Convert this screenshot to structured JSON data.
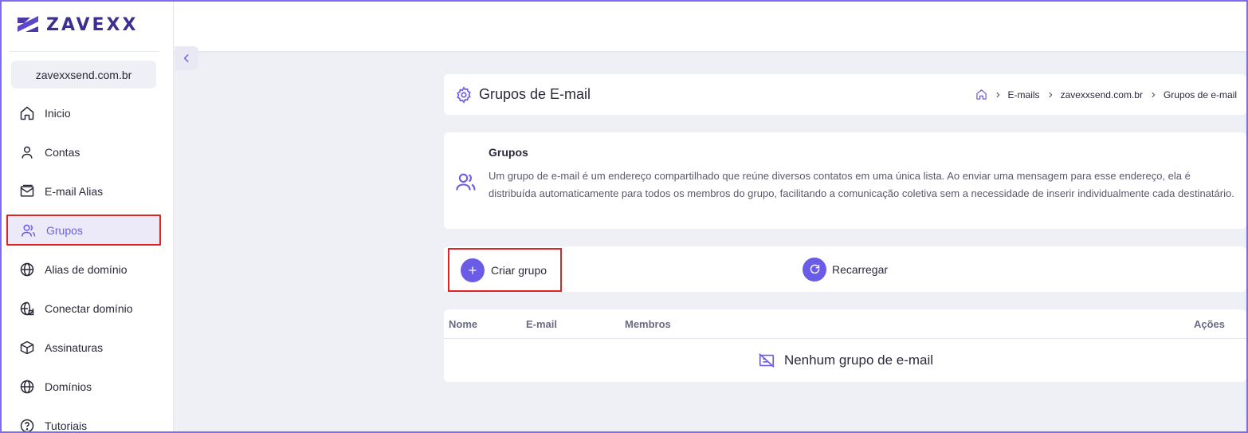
{
  "brand": {
    "name": "ZAVEXX",
    "accent": "#6b5ce7",
    "highlight": "#e02424"
  },
  "sidebar": {
    "domain": "zavexxsend.com.br",
    "items": [
      {
        "label": "Inicio",
        "icon": "home-icon",
        "active": false
      },
      {
        "label": "Contas",
        "icon": "user-icon",
        "active": false
      },
      {
        "label": "E-mail Alias",
        "icon": "mail-alias-icon",
        "active": false
      },
      {
        "label": "Grupos",
        "icon": "users-icon",
        "active": true
      },
      {
        "label": "Alias de domínio",
        "icon": "globe-icon",
        "active": false
      },
      {
        "label": "Conectar domínio",
        "icon": "globe-connect-icon",
        "active": false
      },
      {
        "label": "Assinaturas",
        "icon": "box-icon",
        "active": false
      },
      {
        "label": "Domínios",
        "icon": "globe-icon",
        "active": false
      },
      {
        "label": "Tutoriais",
        "icon": "help-icon",
        "active": false
      }
    ]
  },
  "header": {
    "title": "Grupos de E-mail",
    "breadcrumb": [
      "E-mails",
      "zavexxsend.com.br",
      "Grupos de e-mail"
    ]
  },
  "info": {
    "title": "Grupos",
    "text": "Um grupo de e-mail é um endereço compartilhado que reúne diversos contatos em uma única lista. Ao enviar uma mensagem para esse endereço, ela é distribuída automaticamente para todos os membros do grupo, facilitando a comunicação coletiva sem a necessidade de inserir individualmente cada destinatário."
  },
  "actions": {
    "create_label": "Criar grupo",
    "reload_label": "Recarregar"
  },
  "table": {
    "columns": [
      "Nome",
      "E-mail",
      "Membros",
      "Ações"
    ],
    "empty_text": "Nenhum grupo de e-mail"
  }
}
